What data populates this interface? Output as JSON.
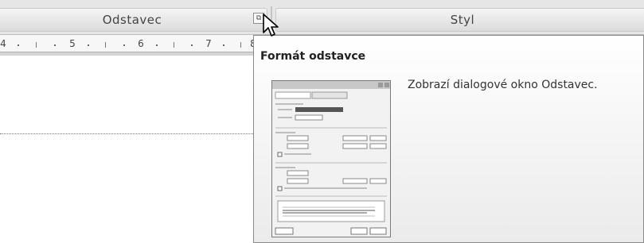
{
  "ribbon": {
    "groups": [
      {
        "label": "Odstavec"
      },
      {
        "label": "Styl"
      }
    ],
    "launcher_glyph": "⧉"
  },
  "ruler": {
    "numbers": [
      "4",
      "5",
      "6",
      "7",
      "8"
    ]
  },
  "tooltip": {
    "title": "Formát odstavce",
    "description": "Zobrazí dialogové okno Odstavec.",
    "preview_icon": "paragraph-dialog-thumbnail"
  },
  "cursor": {
    "icon": "arrow-pointer-icon"
  }
}
